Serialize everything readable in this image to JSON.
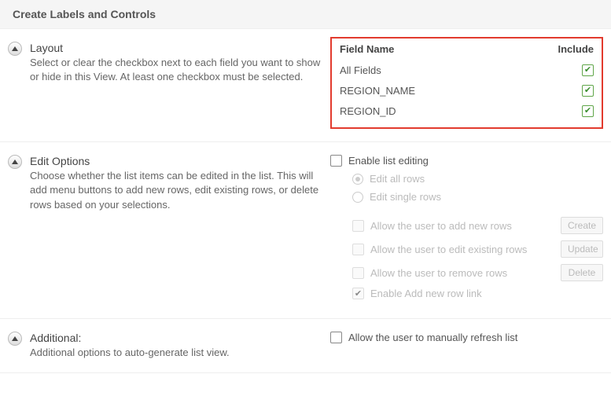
{
  "title": "Create Labels and Controls",
  "layout": {
    "heading": "Layout",
    "desc": "Select or clear the checkbox next to each field you want to show or hide in this View. At least one checkbox must be selected.",
    "header_name": "Field Name",
    "header_include": "Include",
    "rows": [
      {
        "name": "All Fields",
        "include": true
      },
      {
        "name": "REGION_NAME",
        "include": true
      },
      {
        "name": "REGION_ID",
        "include": true
      }
    ]
  },
  "edit": {
    "heading": "Edit Options",
    "desc": "Choose whether the list items can be edited in the list. This will add menu buttons to add new rows, edit existing rows, or delete rows based on your selections.",
    "enable_label": "Enable list editing",
    "radio_all": "Edit all rows",
    "radio_single": "Edit single rows",
    "allow_add": "Allow the user to add new rows",
    "allow_edit": "Allow the user to edit existing rows",
    "allow_remove": "Allow the user to remove rows",
    "enable_link": "Enable Add new row link",
    "btn_create": "Create",
    "btn_update": "Update",
    "btn_delete": "Delete"
  },
  "additional": {
    "heading": "Additional:",
    "desc": "Additional options to auto-generate list view.",
    "refresh_label": "Allow the user to manually refresh list"
  }
}
